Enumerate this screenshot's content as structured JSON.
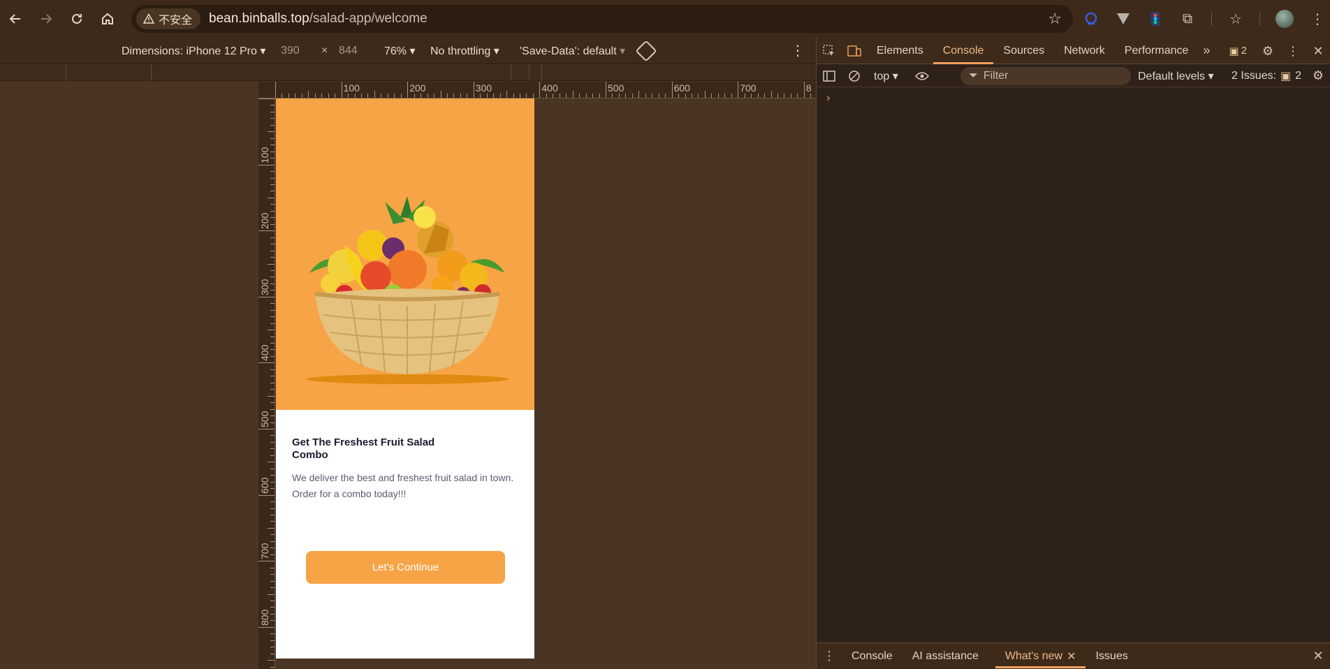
{
  "browser": {
    "back_icon": "arrow-left-icon",
    "forward_icon": "arrow-right-icon",
    "reload_icon": "reload-icon",
    "home_icon": "home-icon",
    "security_label": "不安全",
    "url_host": "bean.binballs.top",
    "url_path": "/salad-app/welcome"
  },
  "device_toolbar": {
    "dimensions_label": "Dimensions: iPhone 12 Pro",
    "width": "390",
    "times": "×",
    "height": "844",
    "zoom": "76%",
    "throttling": "No throttling",
    "save_data": "'Save-Data': default"
  },
  "rulers": {
    "top": [
      "100",
      "200",
      "300",
      "400",
      "500",
      "600",
      "700",
      "8"
    ],
    "left": [
      "100",
      "200",
      "300",
      "400",
      "500",
      "600",
      "700",
      "800"
    ]
  },
  "page": {
    "headline": "Get The Freshest Fruit Salad Combo",
    "description": "We deliver the best and freshest fruit salad in town. Order for a combo today!!!",
    "cta_label": "Let's Continue",
    "colors": {
      "accent": "#f7a446",
      "headline": "#1c1a2e",
      "body": "#5c5b6e"
    }
  },
  "devtools": {
    "tabs": [
      "Elements",
      "Console",
      "Sources",
      "Network",
      "Performance"
    ],
    "active_tab": "Console",
    "issue_badge_count": "2",
    "context": "top",
    "filter_placeholder": "Filter",
    "levels": "Default levels",
    "issues_label": "2 Issues:",
    "issues_count": "2",
    "prompt": "›",
    "drawer_tabs": [
      "Console",
      "AI assistance",
      "What's new",
      "Issues"
    ],
    "drawer_active": "What's new"
  }
}
